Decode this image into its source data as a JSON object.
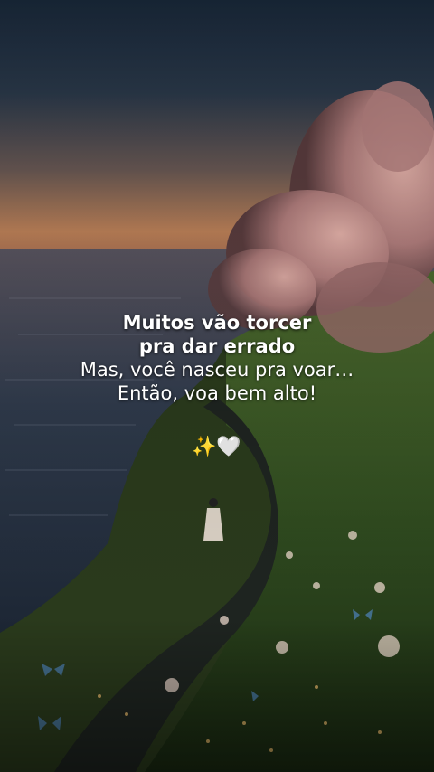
{
  "quote": {
    "line1": "Muitos vão torcer",
    "line2": "pra dar errado",
    "line3": "Mas, você nasceu pra voar…",
    "line4": "Então, voa bem alto!"
  },
  "emoji": "✨🤍",
  "colors": {
    "sky_top": "#1b2b3d",
    "sky_horizon": "#c98a5a",
    "sea": "#2b3747",
    "blossom": "#d9a2a0",
    "grass": "#3d5a28",
    "text": "#ffffff"
  }
}
